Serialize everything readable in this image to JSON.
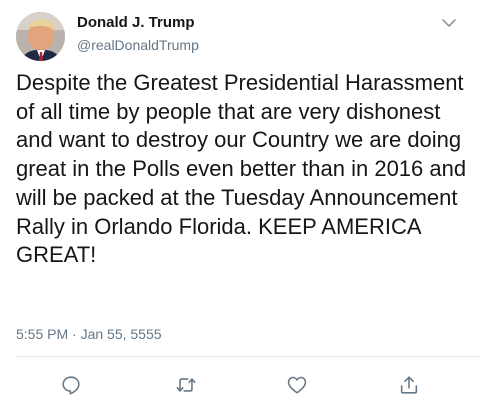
{
  "tweet": {
    "author_name": "Donald J. Trump",
    "author_handle": "@realDonaldTrump",
    "text": "Despite the Greatest Presidential Harassment of all time by people that are very dishonest and want to destroy our Country we are doing great in the Polls even better than in 2016 and will be packed at the Tuesday Announcement Rally in Orlando Florida. KEEP AMERICA GREAT!",
    "timestamp": "5:55 PM · Jan 55, 5555"
  },
  "icons": {
    "menu": "chevron-down-icon",
    "reply": "reply-icon",
    "retweet": "retweet-icon",
    "like": "heart-icon",
    "share": "share-icon"
  },
  "colors": {
    "text": "#14171a",
    "secondary": "#657786",
    "divider": "#e1e8ed",
    "icon": "#657786"
  }
}
